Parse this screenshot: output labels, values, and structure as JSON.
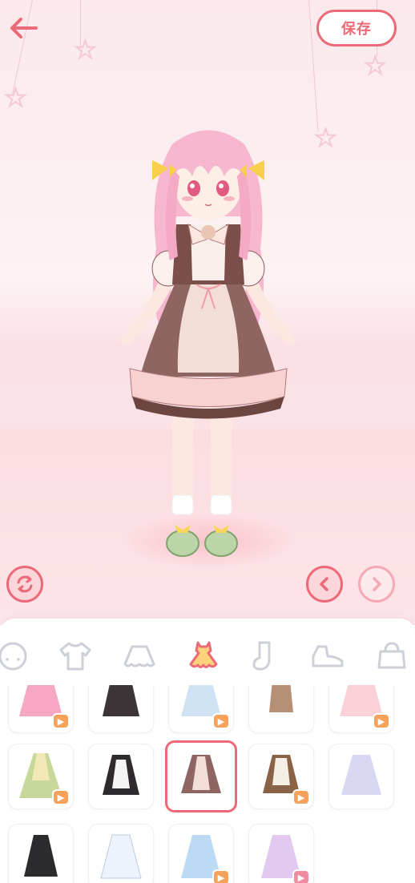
{
  "header": {
    "back_icon": "arrow-left-icon",
    "save_label": "保存"
  },
  "controls": {
    "rotate_icon": "rotate-icon",
    "prev_icon": "chevron-left-icon",
    "next_icon": "chevron-right-icon"
  },
  "colors": {
    "accent": "#ec6a78",
    "accent_light": "#fbd6db",
    "stage_bg": "#fbe9ec",
    "badge": "#f7a25c"
  },
  "tabs": [
    {
      "icon": "face-icon",
      "selected": false
    },
    {
      "icon": "tshirt-icon",
      "selected": false
    },
    {
      "icon": "skirt-icon",
      "selected": false
    },
    {
      "icon": "dress-icon",
      "selected": true
    },
    {
      "icon": "sock-icon",
      "selected": false
    },
    {
      "icon": "shoe-icon",
      "selected": false
    },
    {
      "icon": "bag-icon",
      "selected": false
    }
  ],
  "items": [
    {
      "icon": "pink-dress-item",
      "badge": "video-badge-icon"
    },
    {
      "icon": "black-dress-item",
      "badge": ""
    },
    {
      "icon": "blue-dress-item",
      "badge": "video-badge-icon"
    },
    {
      "icon": "brown-apron-item",
      "badge": ""
    },
    {
      "icon": "floral-dress-item",
      "badge": "video-badge-icon"
    },
    {
      "icon": "green-dress-item",
      "badge": "video-badge-icon"
    },
    {
      "icon": "maid-dress-item",
      "badge": ""
    },
    {
      "icon": "brown-lolita-item",
      "badge": "",
      "selected": true
    },
    {
      "icon": "brown-maid-item",
      "badge": "video-badge-icon"
    },
    {
      "icon": "lavender-dress-item",
      "badge": ""
    },
    {
      "icon": "black-slip-dress-item",
      "badge": ""
    },
    {
      "icon": "white-blue-dress-item",
      "badge": ""
    },
    {
      "icon": "light-blue-dress-item",
      "badge": "video-badge-icon"
    },
    {
      "icon": "lilac-dress-item",
      "badge": "video-badge-icon"
    }
  ]
}
